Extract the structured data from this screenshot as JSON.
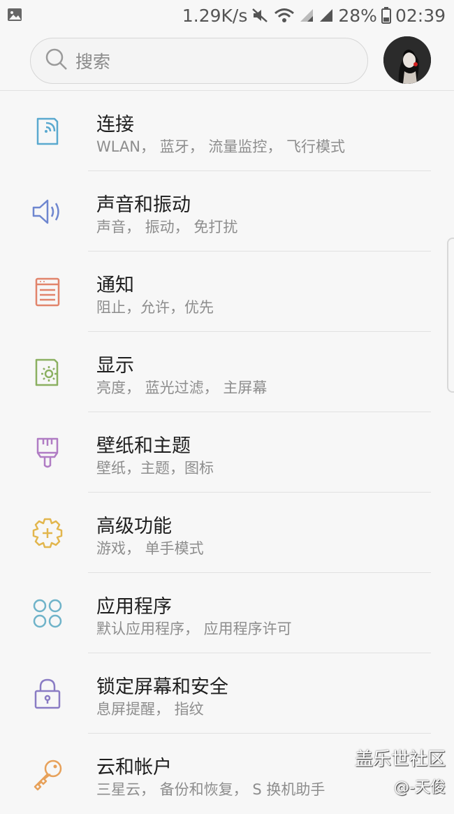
{
  "status_bar": {
    "net_speed": "1.29K/s",
    "battery": "28%",
    "time": "02:39"
  },
  "search": {
    "placeholder": "搜索"
  },
  "settings": [
    {
      "title": "连接",
      "subtitle": "WLAN， 蓝牙， 流量监控， 飞行模式",
      "icon": "connection-icon",
      "color": "#5aa9cf"
    },
    {
      "title": "声音和振动",
      "subtitle": "声音， 振动， 免打扰",
      "icon": "speaker-icon",
      "color": "#6e86cf"
    },
    {
      "title": "通知",
      "subtitle": "阻止，允许，优先",
      "icon": "notification-icon",
      "color": "#e1846b"
    },
    {
      "title": "显示",
      "subtitle": "亮度， 蓝光过滤， 主屏幕",
      "icon": "display-icon",
      "color": "#8bb061"
    },
    {
      "title": "壁纸和主题",
      "subtitle": "壁纸，主题，图标",
      "icon": "paintbrush-icon",
      "color": "#b07cc4"
    },
    {
      "title": "高级功能",
      "subtitle": "游戏， 单手模式",
      "icon": "advanced-gear-icon",
      "color": "#e2b64d"
    },
    {
      "title": "应用程序",
      "subtitle": "默认应用程序， 应用程序许可",
      "icon": "apps-icon",
      "color": "#6fb3c9"
    },
    {
      "title": "锁定屏幕和安全",
      "subtitle": "息屏提醒， 指纹",
      "icon": "lock-icon",
      "color": "#8a7cc4"
    },
    {
      "title": "云和帐户",
      "subtitle": "三星云， 备份和恢复， S 换机助手",
      "icon": "key-icon",
      "color": "#e7a15a"
    }
  ],
  "watermark": {
    "line1": "盖乐世社区",
    "line2": "@-天俊"
  }
}
